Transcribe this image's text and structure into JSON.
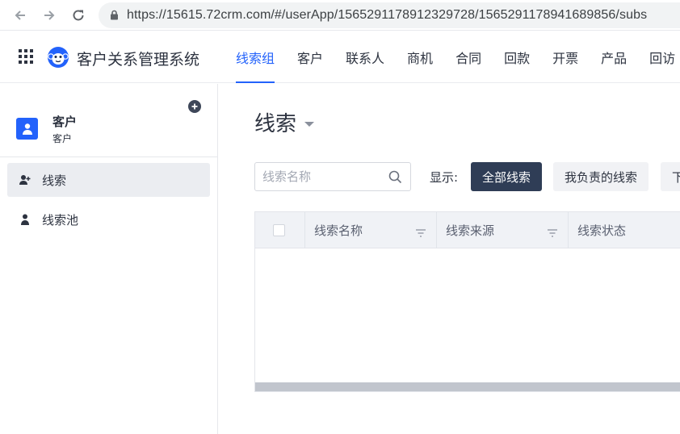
{
  "browser": {
    "url": "https://15615.72crm.com/#/userApp/1565291178912329728/1565291178941689856/subs"
  },
  "header": {
    "system_title": "客户关系管理系统",
    "nav": [
      {
        "label": "线索组",
        "active": true
      },
      {
        "label": "客户"
      },
      {
        "label": "联系人"
      },
      {
        "label": "商机"
      },
      {
        "label": "合同"
      },
      {
        "label": "回款"
      },
      {
        "label": "开票"
      },
      {
        "label": "产品"
      },
      {
        "label": "回访"
      }
    ]
  },
  "sidebar": {
    "title": "客户",
    "subtitle": "客户",
    "items": [
      {
        "label": "线索",
        "icon": "user-add-icon",
        "active": true
      },
      {
        "label": "线索池",
        "icon": "person-icon"
      }
    ]
  },
  "main": {
    "title": "线索",
    "search_placeholder": "线索名称",
    "show_label": "显示:",
    "filters": [
      "全部线索",
      "我负责的线索",
      "下"
    ],
    "columns": [
      "线索名称",
      "线索来源",
      "线索状态"
    ]
  },
  "colors": {
    "accent": "#2362fb",
    "primary_button": "#2f3d56"
  }
}
